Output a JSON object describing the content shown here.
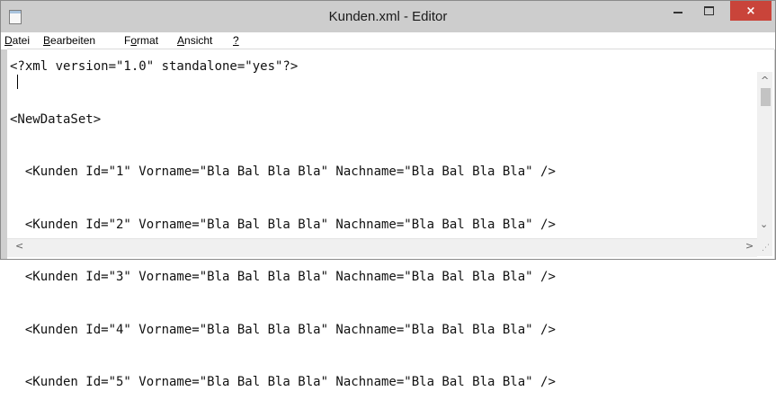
{
  "window": {
    "title": "Kunden.xml - Editor",
    "close_label": "×",
    "icon": "notepad-icon"
  },
  "menu": {
    "items": [
      {
        "accel": "D",
        "rest": "atei"
      },
      {
        "accel": "B",
        "rest": "earbeiten"
      },
      {
        "pre": "F",
        "accel": "o",
        "rest": "rmat"
      },
      {
        "accel": "A",
        "rest": "nsicht"
      },
      {
        "accel": "?",
        "rest": ""
      }
    ]
  },
  "document": {
    "lines": [
      "<?xml version=\"1.0\" standalone=\"yes\"?>",
      "<NewDataSet>",
      "  <Kunden Id=\"1\" Vorname=\"Bla Bal Bla Bla\" Nachname=\"Bla Bal Bla Bla\" />",
      "  <Kunden Id=\"2\" Vorname=\"Bla Bal Bla Bla\" Nachname=\"Bla Bal Bla Bla\" />",
      "  <Kunden Id=\"3\" Vorname=\"Bla Bal Bla Bla\" Nachname=\"Bla Bal Bla Bla\" />",
      "  <Kunden Id=\"4\" Vorname=\"Bla Bal Bla Bla\" Nachname=\"Bla Bal Bla Bla\" />",
      "  <Kunden Id=\"5\" Vorname=\"Bla Bal Bla Bla\" Nachname=\"Bla Bal Bla Bla\" />"
    ]
  },
  "scrollbars": {
    "up": "^",
    "down": "⌄",
    "left": "<",
    "right": ">",
    "grip": "⋰"
  },
  "colors": {
    "titlebar": "#cdcdcd",
    "close_button": "#c9443a"
  }
}
